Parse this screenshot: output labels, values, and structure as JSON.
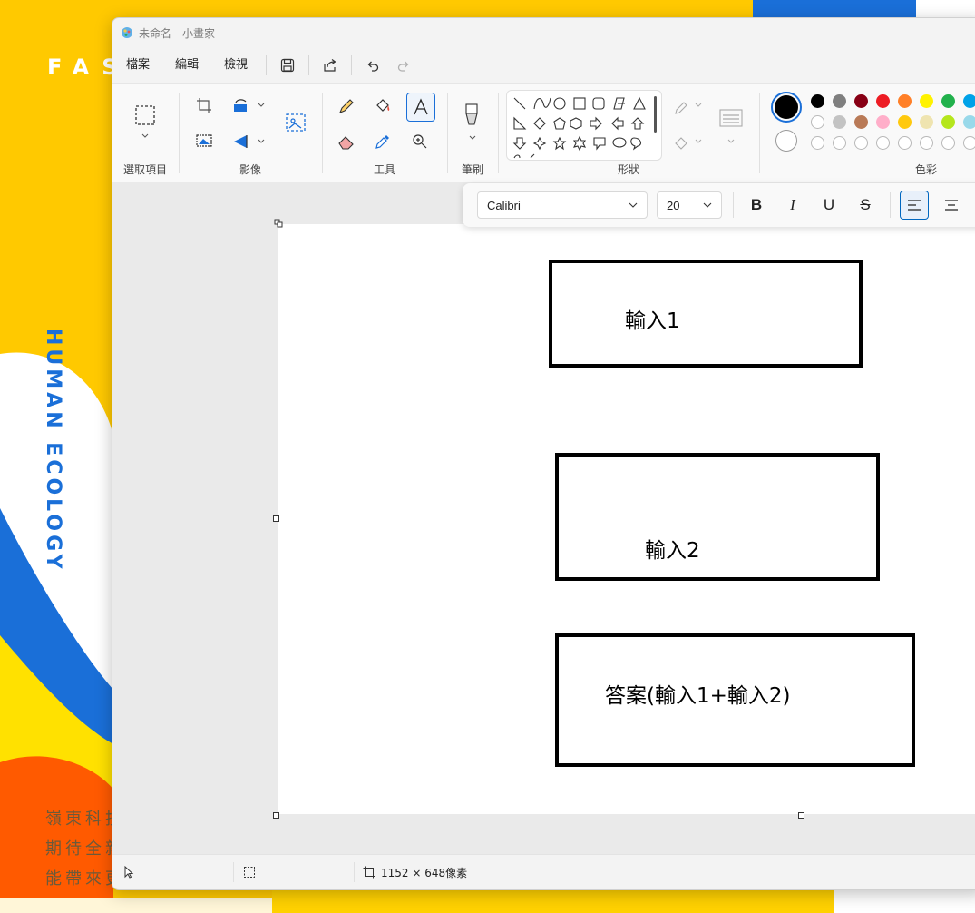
{
  "desktop": {
    "banner_text": "FAS",
    "vertical_text": "HUMAN ECOLOGY",
    "cn_lines": [
      "嶺東科技",
      "期待全新",
      "能帶來更"
    ]
  },
  "window": {
    "title": "未命名 - 小畫家"
  },
  "menu": {
    "file": "檔案",
    "edit": "編輯",
    "view": "檢視"
  },
  "ribbon": {
    "groups": {
      "selection": "選取項目",
      "image": "影像",
      "tools": "工具",
      "brushes": "筆刷",
      "shapes": "形狀",
      "colors": "色彩"
    },
    "colors": {
      "primary": "#000000",
      "secondary": "#ffffff",
      "palette_row1": [
        "#000000",
        "#7f7f7f",
        "#880015",
        "#ed1c24",
        "#ff7f27",
        "#fff200",
        "#22b14c",
        "#00a2e8"
      ],
      "palette_row2": [
        "#ffffff",
        "#c3c3c3",
        "#b97a57",
        "#ffaec9",
        "#ffc90e",
        "#efe4b0",
        "#b5e61d",
        "#99d9ea"
      ]
    }
  },
  "text_toolbar": {
    "font": "Calibri",
    "size": "20",
    "bold": "B",
    "italic": "I",
    "underline": "U",
    "strike": "S"
  },
  "canvas": {
    "boxes": [
      {
        "label": "輸入1"
      },
      {
        "label": "輸入2"
      },
      {
        "label": "答案(輸入1+輸入2)"
      }
    ]
  },
  "status": {
    "canvas_size": "1152 × 648像素"
  }
}
